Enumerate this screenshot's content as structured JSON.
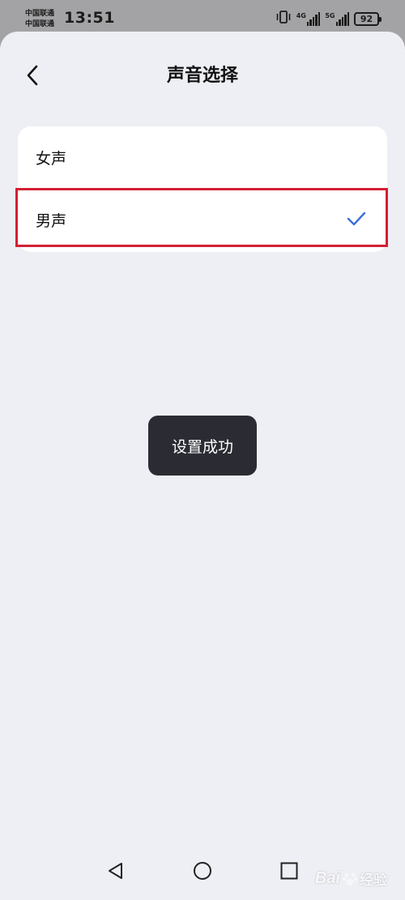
{
  "status_bar": {
    "carrier_1": "中国联通",
    "carrier_2": "中国联通",
    "time": "13:51",
    "network_1": "4G",
    "network_2": "5G",
    "battery": "92",
    "icons": [
      "vibrate-icon",
      "signal-4g-icon",
      "signal-5g-icon",
      "battery-icon"
    ]
  },
  "header": {
    "title": "声音选择",
    "back_icon": "chevron-left-icon"
  },
  "options": [
    {
      "label": "女声",
      "selected": false
    },
    {
      "label": "男声",
      "selected": true
    }
  ],
  "toast": {
    "text": "设置成功"
  },
  "nav": {
    "icons": [
      "triangle-back-icon",
      "circle-home-icon",
      "square-recents-icon"
    ]
  },
  "watermark": {
    "text": "Bai",
    "text_2": "经验"
  },
  "colors": {
    "background": "#eeeff4",
    "card": "#ffffff",
    "accent_check": "#3b6fd8",
    "highlight_border": "#d31f34",
    "toast_bg": "#2b2c33"
  }
}
